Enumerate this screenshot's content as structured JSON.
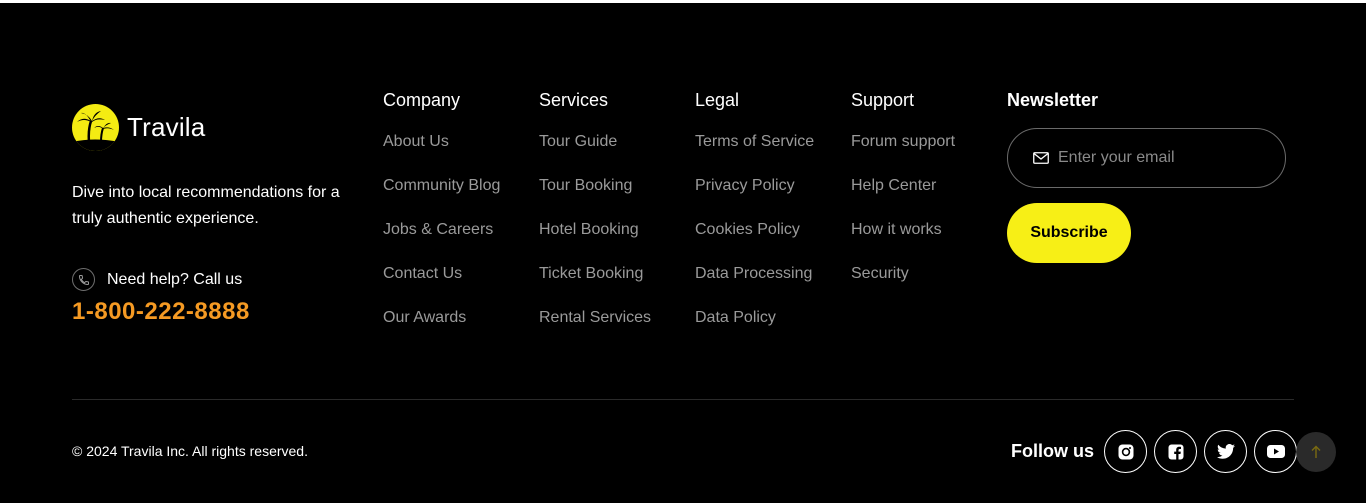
{
  "brand": {
    "name": "Travila"
  },
  "tagline": "Dive into local recommendations for a truly authentic experience.",
  "help": {
    "label": "Need help? Call us",
    "phone": "1-800-222-8888"
  },
  "columns": [
    {
      "title": "Company",
      "links": [
        "About Us",
        "Community Blog",
        "Jobs & Careers",
        "Contact Us",
        "Our Awards"
      ]
    },
    {
      "title": "Services",
      "links": [
        "Tour Guide",
        "Tour Booking",
        "Hotel Booking",
        "Ticket Booking",
        "Rental Services"
      ]
    },
    {
      "title": "Legal",
      "links": [
        "Terms of Service",
        "Privacy Policy",
        "Cookies Policy",
        "Data Processing",
        "Data Policy"
      ]
    },
    {
      "title": "Support",
      "links": [
        "Forum support",
        "Help Center",
        "How it works",
        "Security"
      ]
    }
  ],
  "newsletter": {
    "title": "Newsletter",
    "placeholder": "Enter your email",
    "button": "Subscribe"
  },
  "copyright": "© 2024 Travila Inc. All rights reserved.",
  "follow": {
    "label": "Follow us",
    "icons": [
      "instagram-icon",
      "facebook-icon",
      "twitter-icon",
      "youtube-icon"
    ]
  },
  "colors": {
    "accent": "#f7ef16",
    "phone": "#f59a23",
    "link": "#9a9a9a",
    "background": "#000000"
  }
}
